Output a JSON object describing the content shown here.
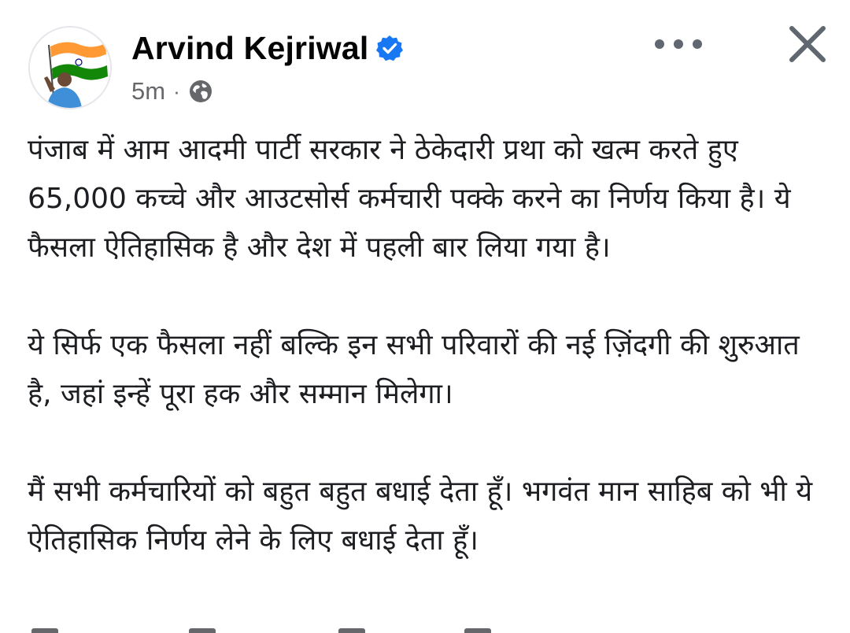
{
  "post": {
    "author": "Arvind Kejriwal",
    "time": "5m",
    "separator": "·",
    "paragraphs": [
      "पंजाब में आम आदमी पार्टी सरकार ने ठेकेदारी प्रथा को खत्म करते हुए 65,000 कच्चे और आउटसोर्स कर्मचारी पक्के करने का निर्णय किया है। ये फैसला ऐतिहासिक है और देश में पहली बार लिया गया है।",
      "ये सिर्फ एक फैसला नहीं बल्कि इन सभी परिवारों की नई ज़िंदगी की शुरुआत है, जहां इन्हें पूरा हक और सम्मान मिलेगा।",
      "मैं सभी कर्मचारियों को बहुत बहुत बधाई देता हूँ। भगवंत मान साहिब को भी ये ऐतिहासिक निर्णय लेने के लिए बधाई देता हूँ।"
    ]
  },
  "icons": {
    "avatar": "profile-picture-with-indian-flag",
    "verified": "verified-badge-icon",
    "audience": "globe-icon",
    "more": "more-options-icon",
    "close": "close-icon"
  },
  "colors": {
    "text": "#1c1e21",
    "secondary": "#65676b",
    "verified_blue": "#1877f2",
    "flag_saffron": "#ff9933",
    "flag_green": "#138808",
    "flag_navy": "#000080"
  }
}
